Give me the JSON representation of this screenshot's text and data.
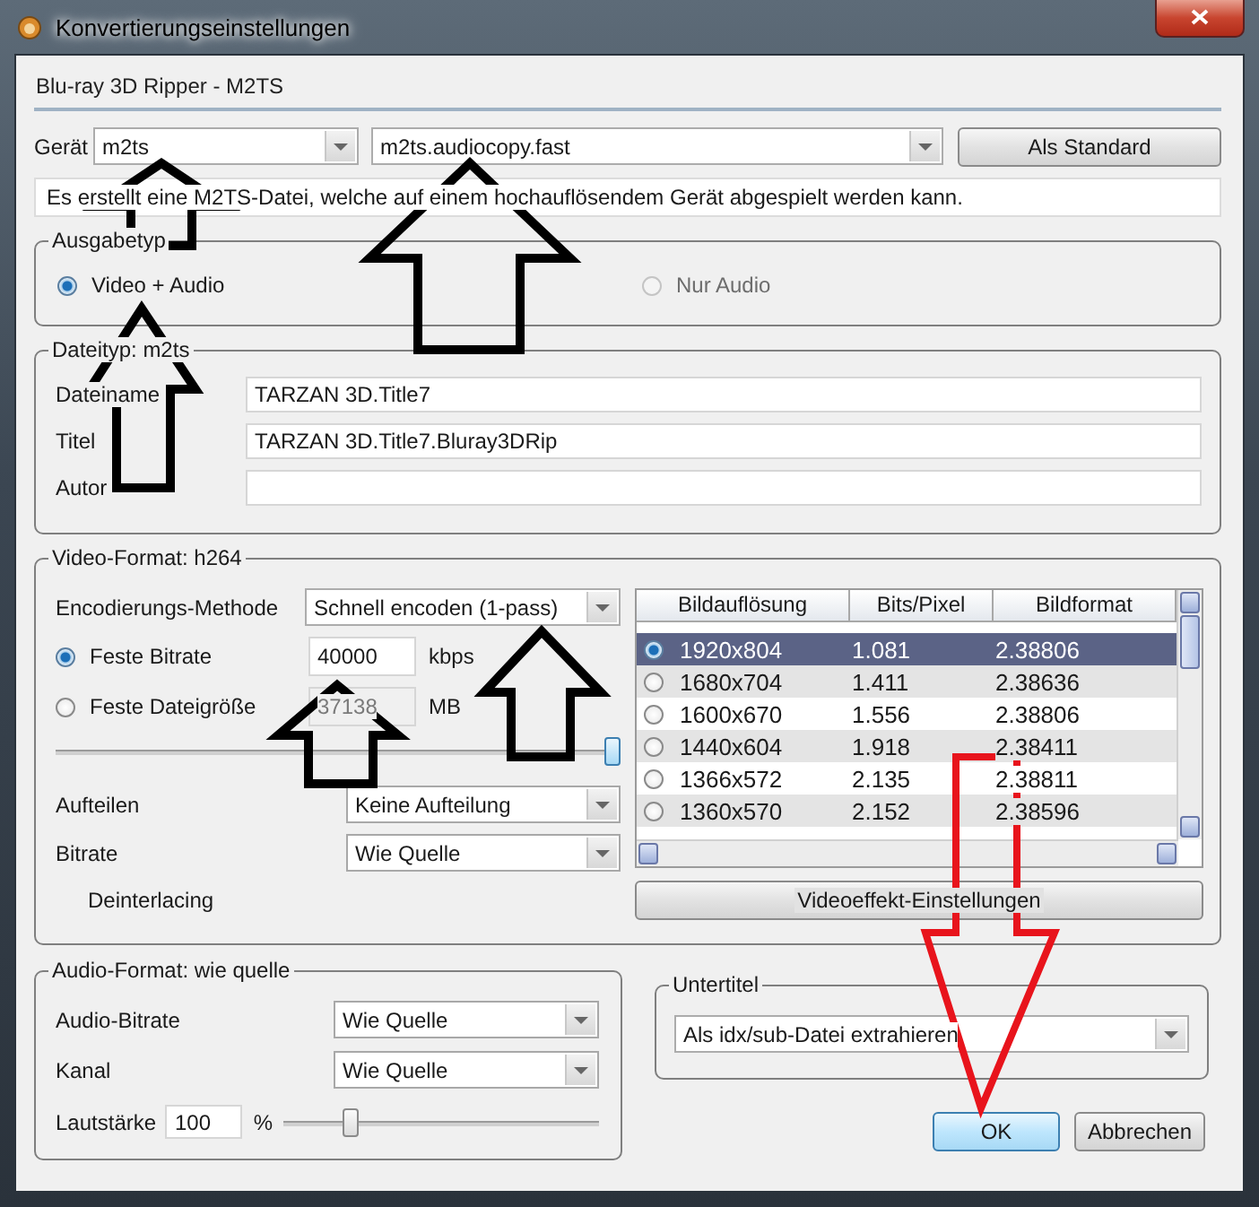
{
  "window": {
    "title": "Konvertierungseinstellungen"
  },
  "header": "Blu-ray 3D Ripper - M2TS",
  "device": {
    "label": "Gerät",
    "device": "m2ts",
    "profile": "m2ts.audiocopy.fast",
    "default_button": "Als Standard"
  },
  "description": "Es erstellt eine M2TS-Datei, welche auf einem hochauflösendem Gerät abgespielt werden kann.",
  "output_type": {
    "title": "Ausgabetyp",
    "options": [
      {
        "label": "Video + Audio",
        "selected": true,
        "disabled": false
      },
      {
        "label": "Nur Audio",
        "selected": false,
        "disabled": true
      }
    ]
  },
  "file": {
    "title": "Dateityp: m2ts",
    "fields": [
      {
        "label": "Dateiname",
        "value": "TARZAN 3D.Title7"
      },
      {
        "label": "Titel",
        "value": "TARZAN 3D.Title7.Bluray3DRip"
      },
      {
        "label": "Autor"
      }
    ]
  },
  "video": {
    "title": "Video-Format: h264",
    "encoding": {
      "label": "Encodierungs-Methode",
      "value": "Schnell encoden (1-pass)"
    },
    "modes": [
      {
        "label": "Feste Bitrate",
        "value": "40000",
        "unit": "kbps",
        "selected": true
      },
      {
        "label": "Feste Dateigröße",
        "value": "37138",
        "unit": "MB",
        "selected": false
      }
    ],
    "quality_slider": {
      "level": 1
    },
    "split": {
      "label": "Aufteilen",
      "value": "Keine Aufteilung"
    },
    "bitrate": {
      "label": "Bitrate",
      "value": "Wie Quelle"
    },
    "deinterlacing": "Deinterlacing",
    "table": {
      "columns": [
        "Bildauflösung",
        "Bits/Pixel",
        "Bildformat"
      ],
      "rows": [
        {
          "resolution": "1920x804",
          "bits_per_pixel": "1.081",
          "aspect": "2.38806",
          "selected": true
        },
        {
          "resolution": "1680x704",
          "bits_per_pixel": "1.411",
          "aspect": "2.38636",
          "selected": false
        },
        {
          "resolution": "1600x670",
          "bits_per_pixel": "1.556",
          "aspect": "2.38806",
          "selected": false
        },
        {
          "resolution": "1440x604",
          "bits_per_pixel": "1.918",
          "aspect": "2.38411",
          "selected": false
        },
        {
          "resolution": "1366x572",
          "bits_per_pixel": "2.135",
          "aspect": "2.38811",
          "selected": false
        },
        {
          "resolution": "1360x570",
          "bits_per_pixel": "2.152",
          "aspect": "2.38596",
          "selected": false
        }
      ]
    },
    "effects_button": "Videoeffekt-Einstellungen"
  },
  "audio": {
    "title": "Audio-Format: wie quelle",
    "bitrate": {
      "label": "Audio-Bitrate",
      "value": "Wie Quelle"
    },
    "channel": {
      "label": "Kanal",
      "value": "Wie Quelle"
    },
    "volume": {
      "label": "Lautstärke",
      "value": "100",
      "unit": "%",
      "level": 0.2
    }
  },
  "subtitles": {
    "title": "Untertitel",
    "value": "Als idx/sub-Datei extrahieren"
  },
  "buttons": [
    {
      "label": "OK",
      "default": true
    },
    {
      "label": "Abbrechen",
      "default": false
    }
  ],
  "annotation_arrows": [
    {
      "color": "#000000"
    },
    {
      "color": "#000000"
    },
    {
      "color": "#000000"
    },
    {
      "color": "#000000"
    },
    {
      "color": "#000000"
    },
    {
      "color": "#e8141c"
    }
  ]
}
